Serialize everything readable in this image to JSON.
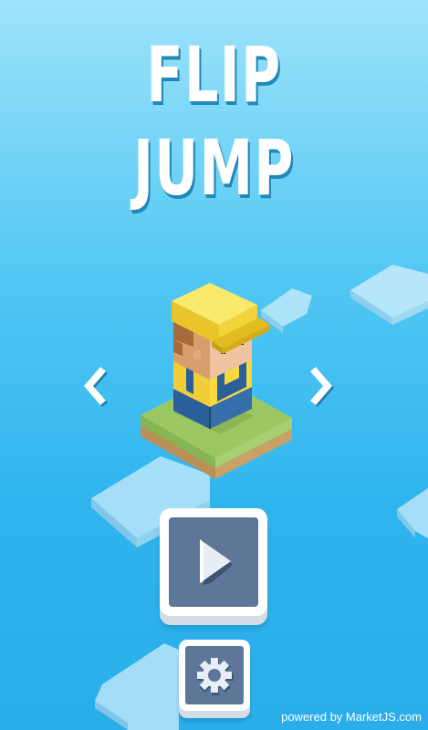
{
  "title": {
    "line1": "FLIP",
    "line2": "JUMP"
  },
  "character_select": {
    "prev_icon": "chevron-left-icon",
    "next_icon": "chevron-right-icon"
  },
  "buttons": {
    "play_icon": "play-icon",
    "settings_icon": "gear-icon"
  },
  "footer": {
    "powered_by": "powered by MarketJS.com"
  },
  "colors": {
    "sky_top": "#9ee3fb",
    "sky_bottom": "#2aaee9",
    "button_face": "#5e7799",
    "button_frame": "#ffffff",
    "hat": "#f2d43a",
    "shirt": "#f3cd37",
    "overalls": "#2b5f9a",
    "grass": "#9cc864",
    "dirt": "#c29a62"
  }
}
